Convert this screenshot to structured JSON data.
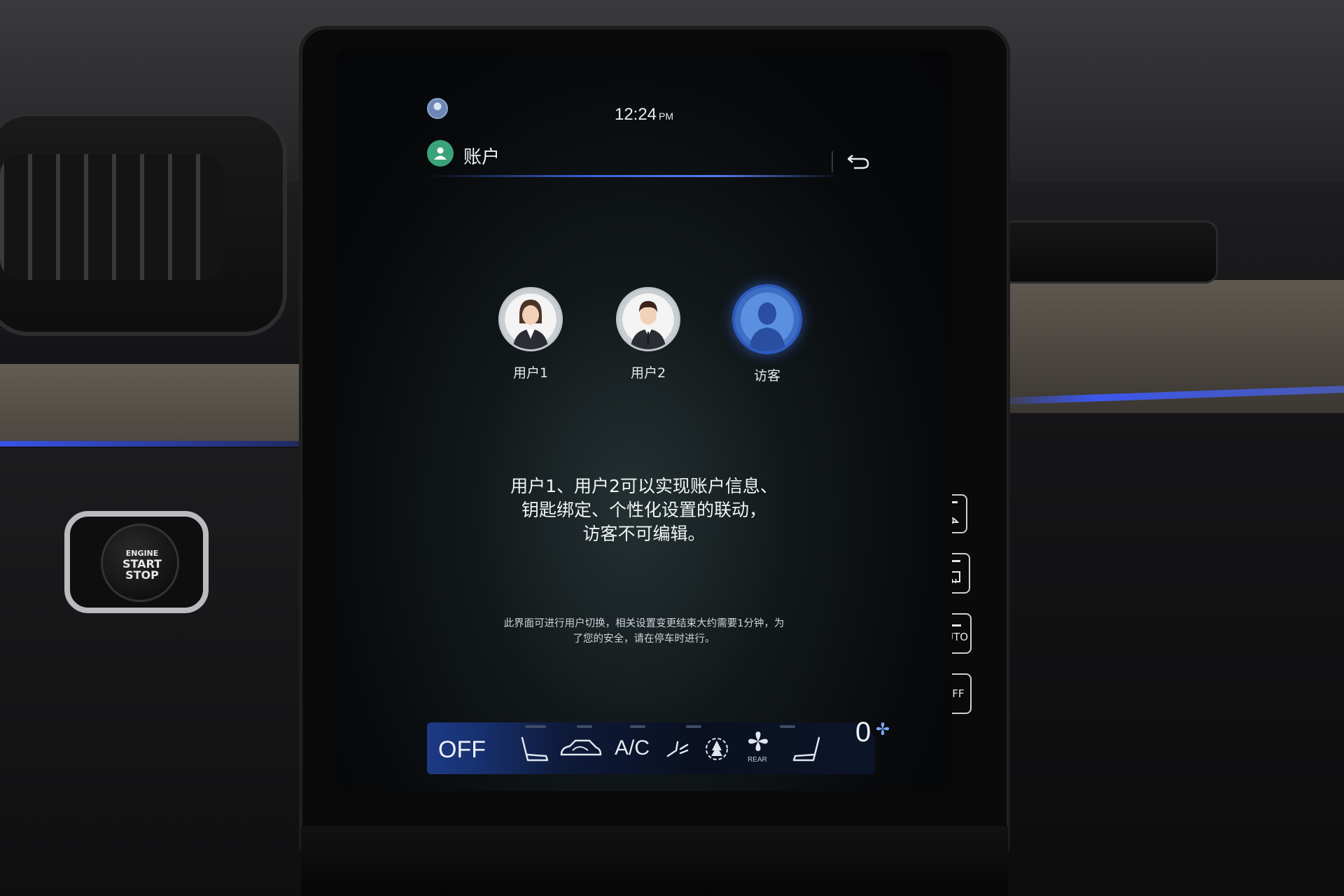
{
  "status_bar": {
    "time": "12:24",
    "ampm": "PM"
  },
  "header": {
    "title": "账户"
  },
  "users": [
    {
      "label": "用户1",
      "icon": "female-user-avatar-icon"
    },
    {
      "label": "用户2",
      "icon": "male-user-avatar-icon"
    },
    {
      "label": "访客",
      "icon": "guest-avatar-icon",
      "selected": true
    }
  ],
  "description": {
    "line1": "用户1、用户2可以实现账户信息、",
    "line2": "钥匙绑定、个性化设置的联动，",
    "line3": "访客不可编辑。"
  },
  "note": {
    "line1": "此界面可进行用户切换，相关设置变更结束大约需要1分钟，为",
    "line2": "了您的安全，请在停车时进行。"
  },
  "climate": {
    "off_label": "OFF",
    "ac_label": "A/C",
    "rear_label": "REAR",
    "fan_speed": "0"
  },
  "hardware_buttons": {
    "volume_plus": "+",
    "volume_minus": "−",
    "auto_label": "AUTO",
    "off_label": "OFF"
  },
  "start_button": {
    "line1": "ENGINE",
    "line2": "START",
    "line3": "STOP"
  },
  "colors": {
    "accent": "#3c61d8",
    "account_icon_bg": "#3aa37c",
    "guest_avatar": "#4a7fd6"
  }
}
